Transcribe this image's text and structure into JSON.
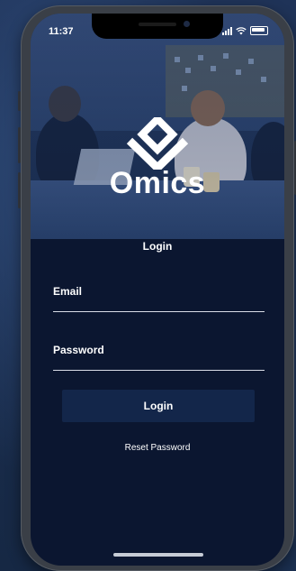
{
  "status_bar": {
    "time": "11:37"
  },
  "brand": {
    "name": "Omics",
    "logo_icon": "omics-chevron-logo-icon"
  },
  "form": {
    "heading": "Login",
    "email_label": "Email",
    "email_value": "",
    "password_label": "Password",
    "password_value": "",
    "submit_label": "Login",
    "reset_label": "Reset Password"
  },
  "colors": {
    "screen_background": "#0b1630",
    "button_background": "#13264a",
    "text": "#ffffff"
  }
}
